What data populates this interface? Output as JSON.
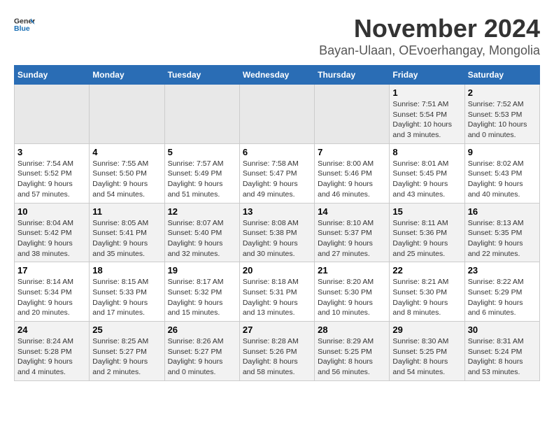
{
  "logo": {
    "text_general": "General",
    "text_blue": "Blue"
  },
  "title": "November 2024",
  "subtitle": "Bayan-Ulaan, OEvoerhangay, Mongolia",
  "weekdays": [
    "Sunday",
    "Monday",
    "Tuesday",
    "Wednesday",
    "Thursday",
    "Friday",
    "Saturday"
  ],
  "weeks": [
    [
      {
        "day": "",
        "empty": true
      },
      {
        "day": "",
        "empty": true
      },
      {
        "day": "",
        "empty": true
      },
      {
        "day": "",
        "empty": true
      },
      {
        "day": "",
        "empty": true
      },
      {
        "day": "1",
        "sunrise": "Sunrise: 7:51 AM",
        "sunset": "Sunset: 5:54 PM",
        "daylight": "Daylight: 10 hours and 3 minutes."
      },
      {
        "day": "2",
        "sunrise": "Sunrise: 7:52 AM",
        "sunset": "Sunset: 5:53 PM",
        "daylight": "Daylight: 10 hours and 0 minutes."
      }
    ],
    [
      {
        "day": "3",
        "sunrise": "Sunrise: 7:54 AM",
        "sunset": "Sunset: 5:52 PM",
        "daylight": "Daylight: 9 hours and 57 minutes."
      },
      {
        "day": "4",
        "sunrise": "Sunrise: 7:55 AM",
        "sunset": "Sunset: 5:50 PM",
        "daylight": "Daylight: 9 hours and 54 minutes."
      },
      {
        "day": "5",
        "sunrise": "Sunrise: 7:57 AM",
        "sunset": "Sunset: 5:49 PM",
        "daylight": "Daylight: 9 hours and 51 minutes."
      },
      {
        "day": "6",
        "sunrise": "Sunrise: 7:58 AM",
        "sunset": "Sunset: 5:47 PM",
        "daylight": "Daylight: 9 hours and 49 minutes."
      },
      {
        "day": "7",
        "sunrise": "Sunrise: 8:00 AM",
        "sunset": "Sunset: 5:46 PM",
        "daylight": "Daylight: 9 hours and 46 minutes."
      },
      {
        "day": "8",
        "sunrise": "Sunrise: 8:01 AM",
        "sunset": "Sunset: 5:45 PM",
        "daylight": "Daylight: 9 hours and 43 minutes."
      },
      {
        "day": "9",
        "sunrise": "Sunrise: 8:02 AM",
        "sunset": "Sunset: 5:43 PM",
        "daylight": "Daylight: 9 hours and 40 minutes."
      }
    ],
    [
      {
        "day": "10",
        "sunrise": "Sunrise: 8:04 AM",
        "sunset": "Sunset: 5:42 PM",
        "daylight": "Daylight: 9 hours and 38 minutes."
      },
      {
        "day": "11",
        "sunrise": "Sunrise: 8:05 AM",
        "sunset": "Sunset: 5:41 PM",
        "daylight": "Daylight: 9 hours and 35 minutes."
      },
      {
        "day": "12",
        "sunrise": "Sunrise: 8:07 AM",
        "sunset": "Sunset: 5:40 PM",
        "daylight": "Daylight: 9 hours and 32 minutes."
      },
      {
        "day": "13",
        "sunrise": "Sunrise: 8:08 AM",
        "sunset": "Sunset: 5:38 PM",
        "daylight": "Daylight: 9 hours and 30 minutes."
      },
      {
        "day": "14",
        "sunrise": "Sunrise: 8:10 AM",
        "sunset": "Sunset: 5:37 PM",
        "daylight": "Daylight: 9 hours and 27 minutes."
      },
      {
        "day": "15",
        "sunrise": "Sunrise: 8:11 AM",
        "sunset": "Sunset: 5:36 PM",
        "daylight": "Daylight: 9 hours and 25 minutes."
      },
      {
        "day": "16",
        "sunrise": "Sunrise: 8:13 AM",
        "sunset": "Sunset: 5:35 PM",
        "daylight": "Daylight: 9 hours and 22 minutes."
      }
    ],
    [
      {
        "day": "17",
        "sunrise": "Sunrise: 8:14 AM",
        "sunset": "Sunset: 5:34 PM",
        "daylight": "Daylight: 9 hours and 20 minutes."
      },
      {
        "day": "18",
        "sunrise": "Sunrise: 8:15 AM",
        "sunset": "Sunset: 5:33 PM",
        "daylight": "Daylight: 9 hours and 17 minutes."
      },
      {
        "day": "19",
        "sunrise": "Sunrise: 8:17 AM",
        "sunset": "Sunset: 5:32 PM",
        "daylight": "Daylight: 9 hours and 15 minutes."
      },
      {
        "day": "20",
        "sunrise": "Sunrise: 8:18 AM",
        "sunset": "Sunset: 5:31 PM",
        "daylight": "Daylight: 9 hours and 13 minutes."
      },
      {
        "day": "21",
        "sunrise": "Sunrise: 8:20 AM",
        "sunset": "Sunset: 5:30 PM",
        "daylight": "Daylight: 9 hours and 10 minutes."
      },
      {
        "day": "22",
        "sunrise": "Sunrise: 8:21 AM",
        "sunset": "Sunset: 5:30 PM",
        "daylight": "Daylight: 9 hours and 8 minutes."
      },
      {
        "day": "23",
        "sunrise": "Sunrise: 8:22 AM",
        "sunset": "Sunset: 5:29 PM",
        "daylight": "Daylight: 9 hours and 6 minutes."
      }
    ],
    [
      {
        "day": "24",
        "sunrise": "Sunrise: 8:24 AM",
        "sunset": "Sunset: 5:28 PM",
        "daylight": "Daylight: 9 hours and 4 minutes."
      },
      {
        "day": "25",
        "sunrise": "Sunrise: 8:25 AM",
        "sunset": "Sunset: 5:27 PM",
        "daylight": "Daylight: 9 hours and 2 minutes."
      },
      {
        "day": "26",
        "sunrise": "Sunrise: 8:26 AM",
        "sunset": "Sunset: 5:27 PM",
        "daylight": "Daylight: 9 hours and 0 minutes."
      },
      {
        "day": "27",
        "sunrise": "Sunrise: 8:28 AM",
        "sunset": "Sunset: 5:26 PM",
        "daylight": "Daylight: 8 hours and 58 minutes."
      },
      {
        "day": "28",
        "sunrise": "Sunrise: 8:29 AM",
        "sunset": "Sunset: 5:25 PM",
        "daylight": "Daylight: 8 hours and 56 minutes."
      },
      {
        "day": "29",
        "sunrise": "Sunrise: 8:30 AM",
        "sunset": "Sunset: 5:25 PM",
        "daylight": "Daylight: 8 hours and 54 minutes."
      },
      {
        "day": "30",
        "sunrise": "Sunrise: 8:31 AM",
        "sunset": "Sunset: 5:24 PM",
        "daylight": "Daylight: 8 hours and 53 minutes."
      }
    ]
  ]
}
